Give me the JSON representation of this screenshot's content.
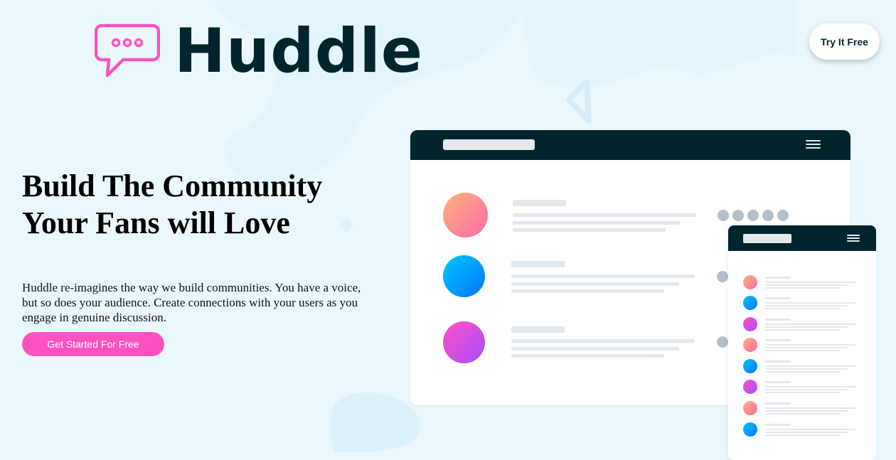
{
  "brand": {
    "name": "Huddle",
    "primary_color": "#00252e",
    "accent_color": "#ff52c1",
    "background_color": "#eaf8fd"
  },
  "header": {
    "try_button_label": "Try It Free"
  },
  "hero": {
    "title_line1": "Build The Community",
    "title_line2": "Your Fans will Love",
    "description": "Huddle re-imagines the way we build communities. You have a voice, but so does your audience. Create connections with your users as you engage in genuine discussion.",
    "cta_label": "Get Started For Free"
  },
  "icons": [
    "chat-bubble-logo-icon",
    "hamburger-menu-icon"
  ]
}
